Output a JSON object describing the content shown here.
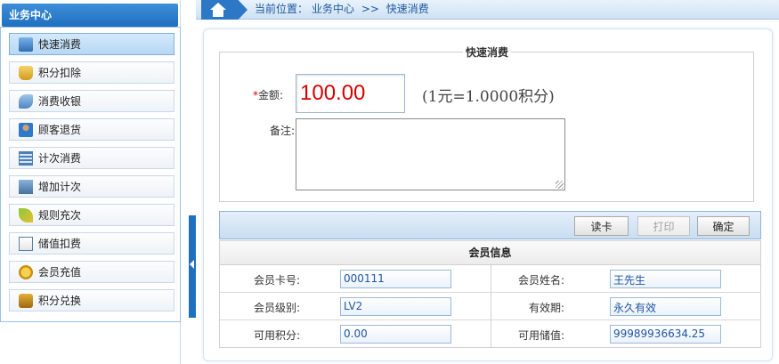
{
  "sidebar": {
    "title": "业务中心",
    "items": [
      {
        "label": "快速消费",
        "icon": "quick-consume-icon"
      },
      {
        "label": "积分扣除",
        "icon": "points-deduct-icon"
      },
      {
        "label": "消费收银",
        "icon": "cashier-icon"
      },
      {
        "label": "顾客退货",
        "icon": "customer-return-icon"
      },
      {
        "label": "计次消费",
        "icon": "count-consume-icon"
      },
      {
        "label": "增加计次",
        "icon": "add-count-icon"
      },
      {
        "label": "规则充次",
        "icon": "rule-recharge-icon"
      },
      {
        "label": "储值扣费",
        "icon": "stored-value-icon"
      },
      {
        "label": "会员充值",
        "icon": "member-recharge-icon"
      },
      {
        "label": "积分兑换",
        "icon": "points-exchange-icon"
      }
    ],
    "active_index": 0
  },
  "breadcrumb": {
    "prefix": "当前位置：",
    "section": "业务中心",
    "separator": ">>",
    "page": "快速消费"
  },
  "form": {
    "legend": "快速消费",
    "amount_required_mark": "*",
    "amount_label": "金额:",
    "amount_value": "100.00",
    "rate_text": "(1元=1.0000积分)",
    "note_label": "备注:",
    "note_value": ""
  },
  "toolbar": {
    "read_card": "读卡",
    "print": "打印",
    "confirm": "确定"
  },
  "member": {
    "title": "会员信息",
    "card_no_label": "会员卡号:",
    "card_no": "000111",
    "name_label": "会员姓名:",
    "name": "王先生",
    "level_label": "会员级别:",
    "level": "LV2",
    "valid_label": "有效期:",
    "valid": "永久有效",
    "points_label": "可用积分:",
    "points": "0.00",
    "balance_label": "可用储值:",
    "balance": "99989936634.25"
  },
  "colors": {
    "accent": "#1f6fc0",
    "amount_text": "#d90000",
    "breadcrumb_text": "#1d5aa0"
  }
}
